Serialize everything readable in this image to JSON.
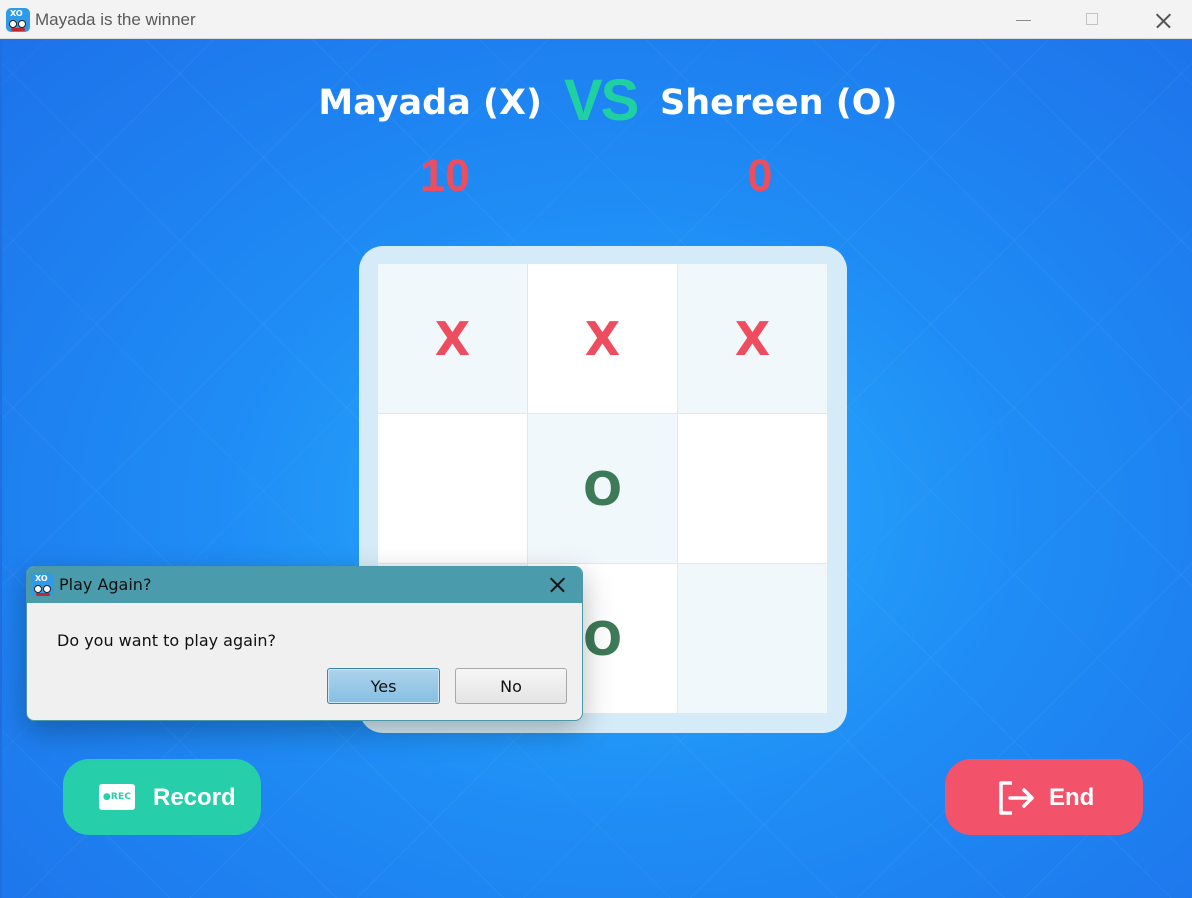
{
  "window": {
    "title": "Mayada is the winner",
    "controls": {
      "minimize": "minimize",
      "maximize": "maximize",
      "close": "close"
    }
  },
  "app_icon": {
    "text": "XO"
  },
  "players": {
    "one": {
      "name": "Mayada (X)",
      "score": "10"
    },
    "vs": "VS",
    "two": {
      "name": "Shereen (O)",
      "score": "0"
    }
  },
  "board": {
    "cells": [
      "X",
      "X",
      "X",
      "",
      "O",
      "",
      "",
      "O",
      ""
    ]
  },
  "buttons": {
    "record": {
      "label": "Record",
      "icon": "rec-icon",
      "icon_text": "●REC"
    },
    "end": {
      "label": "End",
      "icon": "exit-icon"
    }
  },
  "dialog": {
    "title": "Play Again?",
    "message": "Do you want to play again?",
    "yes": "Yes",
    "no": "No"
  },
  "colors": {
    "x_mark": "#ee4d5f",
    "o_mark": "#3d7a57",
    "vs": "#1fd0a3",
    "score": "#ee4d5f",
    "record_button": "#26cfaa",
    "end_button": "#f3536a",
    "dialog_titlebar": "#4a9bab"
  }
}
